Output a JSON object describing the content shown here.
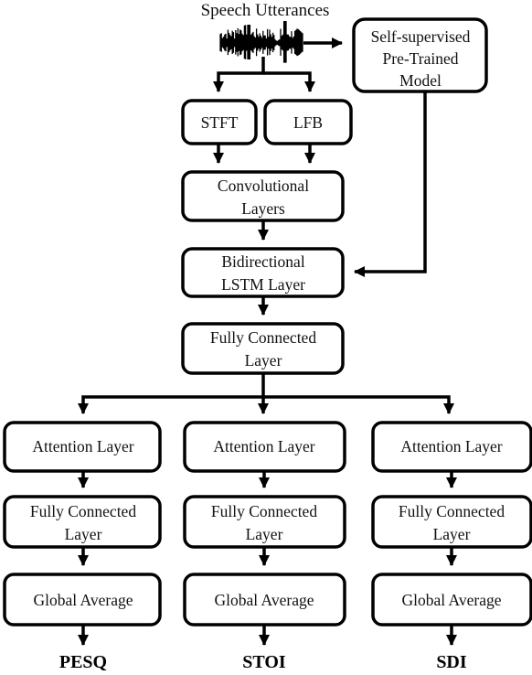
{
  "diagram": {
    "input_label": "Speech Utterances",
    "input_icon": "waveform-icon",
    "nodes": {
      "ssl_model": [
        "Self-supervised",
        "Pre-Trained",
        "Model"
      ],
      "stft": [
        "STFT"
      ],
      "lfb": [
        "LFB"
      ],
      "conv": [
        "Convolutional",
        "Layers"
      ],
      "blstm": [
        "Bidirectional",
        "LSTM Layer"
      ],
      "fc_shared": [
        "Fully Connected",
        "Layer"
      ]
    },
    "branches": [
      {
        "attention": "Attention Layer",
        "fc": [
          "Fully Connected",
          "Layer"
        ],
        "pool": "Global Average",
        "output": "PESQ"
      },
      {
        "attention": "Attention Layer",
        "fc": [
          "Fully Connected",
          "Layer"
        ],
        "pool": "Global Average",
        "output": "STOI"
      },
      {
        "attention": "Attention Layer",
        "fc": [
          "Fully Connected",
          "Layer"
        ],
        "pool": "Global Average",
        "output": "SDI"
      }
    ],
    "edges": [
      [
        "input",
        "ssl_model"
      ],
      [
        "input",
        "stft"
      ],
      [
        "input",
        "lfb"
      ],
      [
        "stft",
        "conv"
      ],
      [
        "lfb",
        "conv"
      ],
      [
        "conv",
        "blstm"
      ],
      [
        "ssl_model",
        "blstm"
      ],
      [
        "blstm",
        "fc_shared"
      ],
      [
        "fc_shared",
        "attention"
      ],
      [
        "attention",
        "fc"
      ],
      [
        "fc",
        "pool"
      ],
      [
        "pool",
        "output"
      ]
    ]
  }
}
